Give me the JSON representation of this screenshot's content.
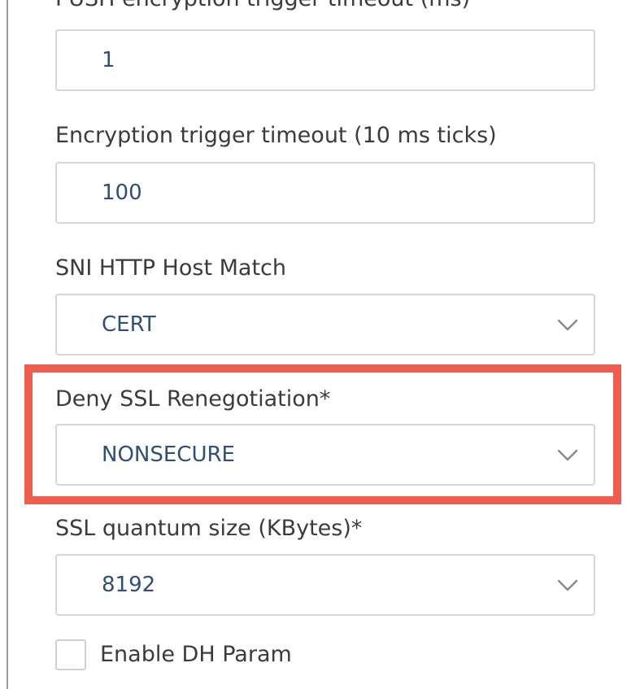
{
  "fields": {
    "push_timeout": {
      "label": "PUSH encryption trigger timeout (ms)",
      "value": "1"
    },
    "encryption_trigger_timeout": {
      "label": "Encryption trigger timeout (10 ms ticks)",
      "value": "100"
    },
    "sni_http_host_match": {
      "label": "SNI HTTP Host Match",
      "value": "CERT"
    },
    "deny_ssl_renegotiation": {
      "label": "Deny SSL Renegotiation*",
      "value": "NONSECURE"
    },
    "ssl_quantum_size": {
      "label": "SSL quantum size (KBytes)*",
      "value": "8192"
    }
  },
  "checkbox": {
    "enable_dh_param": {
      "label": "Enable DH Param",
      "checked": false
    }
  },
  "icons": {
    "dropdown": "chevron-down-icon"
  },
  "colors": {
    "highlight": "#ee5e4e",
    "value_text": "#2f4f79",
    "label_text": "#3b3b3b",
    "field_border": "#d6d6d6"
  }
}
